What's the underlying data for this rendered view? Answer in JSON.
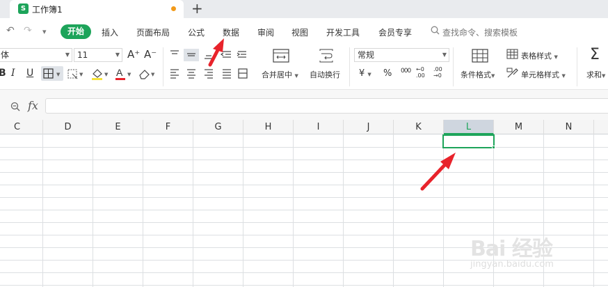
{
  "tabbar": {
    "doc_icon_letter": "S",
    "doc_title": "工作簿1",
    "new_tab_label": "+"
  },
  "quick_access": {
    "undo": "↶",
    "redo": "↷",
    "more": "▾"
  },
  "menu": {
    "items": [
      "开始",
      "插入",
      "页面布局",
      "公式",
      "数据",
      "审阅",
      "视图",
      "开发工具",
      "会员专享"
    ],
    "active_index": 0,
    "search_placeholder": "查找命令、搜索模板"
  },
  "ribbon": {
    "font_name": "体",
    "font_size": "11",
    "grow_font": "A⁺",
    "shrink_font": "A⁻",
    "bold": "B",
    "italic": "I",
    "underline": "U",
    "merge_center": "合并居中",
    "wrap_text": "自动换行",
    "number_format": "常规",
    "currency": "¥",
    "percent": "%",
    "thousands": "000",
    "inc_decimal": "←0 .00",
    "dec_decimal": ".00 →0",
    "conditional_format": "条件格式",
    "table_style": "表格样式",
    "cell_style": "单元格样式",
    "sum_symbol": "Σ",
    "sum_label": "求和"
  },
  "formula_bar": {
    "fx_label": "fx",
    "value": ""
  },
  "grid": {
    "columns": [
      "C",
      "D",
      "E",
      "F",
      "G",
      "H",
      "I",
      "J",
      "K",
      "L",
      "M",
      "N"
    ],
    "active_column": "L",
    "active_cell_value": ""
  },
  "watermark": {
    "logo": "Bai 经验",
    "url": "jingyan.baidu.com"
  },
  "colors": {
    "accent_green": "#1da45a",
    "annotation_red": "#e8232b",
    "unsaved_dot": "#f29a1a"
  }
}
